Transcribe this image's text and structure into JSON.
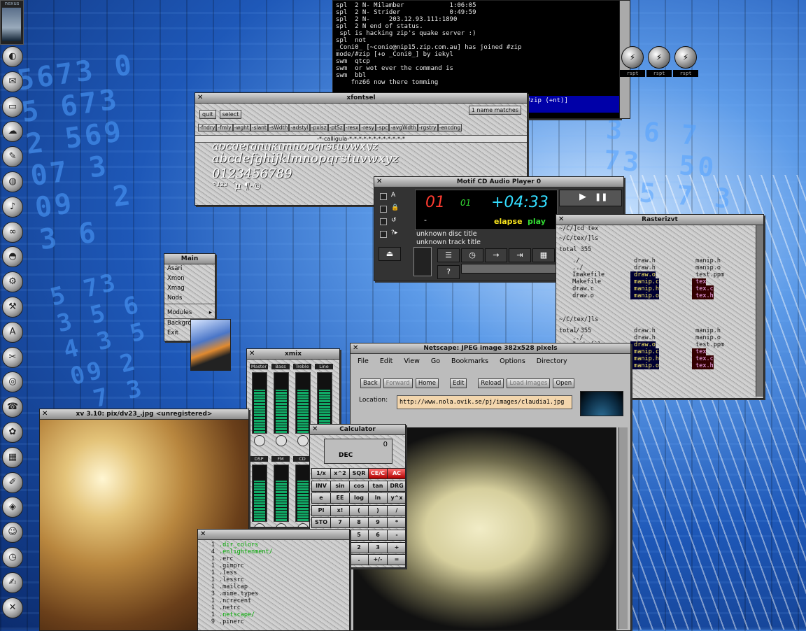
{
  "colors": {
    "accent_blue": "#1e58b8",
    "terminal_bg": "#000000",
    "cd_red": "#ff3b30",
    "cd_green": "#33dd33",
    "cd_cyan": "#33ddff",
    "cd_yellow": "#f5e11d"
  },
  "digits": {
    "a": "5673 0\n5 673\n2 569\n07 3\n09  2\n3 6",
    "b": "3 6 7\n73  50\n5 5 7 3\n0  09\n57  5",
    "c": "5 73\n3 5 6\n4 3 5\n09 2\n 7 3"
  },
  "pager": {
    "title": "nexus"
  },
  "dock": {
    "icons": [
      "world-icon",
      "mail-icon",
      "drive-icon",
      "cloud-icon",
      "pen-icon",
      "globe-icon",
      "speaker-icon",
      "tape-icon",
      "disk-icon",
      "gear-icon",
      "wrench-icon",
      "font-icon",
      "tools-icon",
      "cd-icon",
      "phone-icon",
      "shell-icon",
      "calc-icon",
      "pencil-icon",
      "cube-icon",
      "monkey-icon",
      "clock-icon",
      "paint-icon",
      "exit-icon"
    ],
    "glyphs": [
      "◐",
      "✉",
      "▭",
      "☁",
      "✎",
      "◍",
      "♪",
      "∞",
      "◓",
      "⚙",
      "⚒",
      "A",
      "✂",
      "◎",
      "☎",
      "✿",
      "▦",
      "✐",
      "◈",
      "☺",
      "◷",
      "✍",
      "✕"
    ]
  },
  "irc": {
    "lines": [
      "spl  2 N- Milamber            1:06:05",
      "spl  2 N- Strider             0:49:59",
      "spl  2 N-     203.12.93.111:1890",
      "spl  2 N end of status.",
      " spl is hacking zip's quake server :)",
      "spl  not",
      "_Coni0_ [~conio@nip15.zip.com.au] has joined #zip",
      "mode/#zip [+o _Coni0_] by iekyl",
      "swm  qtcp",
      "swm  or wot ever the command is",
      "swm  bbl",
      "    fnz66 now there tomming"
    ],
    "status": "on #zip (+nt)]"
  },
  "quake_icons": [
    {
      "label": "rspt"
    },
    {
      "label": "rspt"
    },
    {
      "label": "rspt"
    }
  ],
  "xfontsel": {
    "title": "xfontsel",
    "quit": "quit",
    "select": "select",
    "matches": "1 name matches",
    "fields": [
      "-fndry",
      "-fmly",
      "-wght",
      "-slant",
      "-sWdth",
      "-adstyl",
      "-pxlsz",
      "-ptSz",
      "-resx",
      "-resy",
      "-spc",
      "-avgWdth",
      "-rgstry",
      "-encdng"
    ],
    "pattern": "-*-calligula-*-*-*-*-*-*-*-*-*-*-*-*",
    "sample1": "abcdefghijklmnopqrstuvwxyz",
    "sample2": "abcdefghijklmnopqrstuvwxyz",
    "sample3": "0123456789",
    "sample4": "°¹²³ ´µ ¶·©"
  },
  "cdplayer": {
    "title": "Motif CD Audio Player 0",
    "track": "01",
    "index": "01",
    "time": "+04:33",
    "dash": "-",
    "mode_elapse": "elapse",
    "mode_play": "play",
    "disc_title": "unknown disc title",
    "track_title": "unknown track title",
    "volume": "100",
    "check_labels": [
      "A",
      "🔒",
      "↺",
      "?▸"
    ],
    "buttons": [
      "⏏",
      "☰",
      "◷",
      "→",
      "⇥",
      "▦",
      "?"
    ],
    "transport": [
      "▶",
      "❚❚"
    ]
  },
  "root_menu": {
    "title": "Main",
    "items": [
      "Asari",
      "Xmon",
      "Xmag",
      "Nods",
      "Modules",
      "Background",
      "Exit"
    ],
    "submenu_arrow": "▸"
  },
  "rxvt": {
    "title": "Rasterizvt",
    "lines": [
      "~/C/]cd tex",
      "~/C/tex/]ls",
      "total 355",
      "~/C/tex/]ls",
      "total 355",
      "~/C/tex/]"
    ],
    "files1": [
      " ./",
      " ../",
      " Imakefile",
      " Makefile",
      " draw.c",
      " draw.o"
    ],
    "files2": [
      " draw.h",
      " draw.h",
      " draw.o",
      " manip.c",
      " manip.h",
      " manip.o"
    ],
    "files3": [
      " manip.h",
      " manip.o",
      " test.ppm",
      " tex",
      " tex.c",
      " tex.h"
    ]
  },
  "xmixer": {
    "title": "xmix",
    "channels": [
      "Master",
      "Bass",
      "Treble",
      "Line"
    ],
    "channels2": [
      "DSP",
      "FM",
      "CD",
      "Mic"
    ],
    "level": 0.72
  },
  "netscape": {
    "title": "Netscape: JPEG image 382x528 pixels",
    "menu": [
      "File",
      "Edit",
      "View",
      "Go",
      "Bookmarks",
      "Options",
      "Directory"
    ],
    "toolbar": [
      "Back",
      "Forward",
      "Home",
      "Edit",
      "Reload",
      "Load Images",
      "Open"
    ],
    "location_label": "Location:",
    "url": "http://www.nola.ovik.se/pj/images/claudia1.jpg"
  },
  "xv": {
    "title": "xv 3.10: pix/dv23_.jpg <unregistered>"
  },
  "calculator": {
    "title": "Calculator",
    "display": "0",
    "mode": "DEC",
    "rows": [
      [
        "1/x",
        "x^2",
        "SQR",
        "CE/C",
        "AC"
      ],
      [
        "INV",
        "sin",
        "cos",
        "tan",
        "DRG"
      ],
      [
        "e",
        "EE",
        "log",
        "ln",
        "y^x"
      ],
      [
        "PI",
        "x!",
        "(",
        ")",
        "/"
      ],
      [
        "STO",
        "7",
        "8",
        "9",
        "*"
      ],
      [
        "RCL",
        "4",
        "5",
        "6",
        "-"
      ],
      [
        "SUM",
        "1",
        "2",
        "3",
        "+"
      ],
      [
        "EXC",
        "0",
        ".",
        "+/-",
        "="
      ]
    ]
  },
  "dirlist": {
    "entries": [
      ".dir_colors",
      ".enlightenment/",
      ".erc",
      ".gimprc",
      ".less",
      ".lessrc",
      ".mailcap",
      ".mime.types",
      ".ncrecent",
      ".netrc",
      ".netscape/",
      ".pinerc"
    ],
    "sizes": [
      "1",
      "4",
      "1",
      "1",
      "1",
      "1",
      "1",
      "3",
      "1",
      "1",
      "1",
      "9"
    ]
  }
}
